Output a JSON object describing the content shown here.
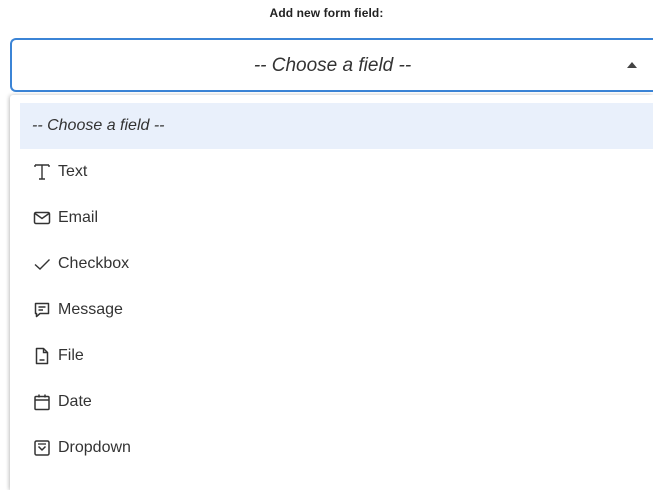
{
  "header": {
    "label": "Add new form field:"
  },
  "select": {
    "value": "-- Choose a field --",
    "expanded": true
  },
  "colors": {
    "accent_border": "#3b84d6",
    "selected_row": "#e9f0fb"
  },
  "menu": {
    "options": [
      {
        "label": "-- Choose a field --",
        "icon": "",
        "selected": true
      },
      {
        "label": "Text",
        "icon": "text-icon"
      },
      {
        "label": "Email",
        "icon": "envelope-icon"
      },
      {
        "label": "Checkbox",
        "icon": "checkmark-icon"
      },
      {
        "label": "Message",
        "icon": "message-icon"
      },
      {
        "label": "File",
        "icon": "file-icon"
      },
      {
        "label": "Date",
        "icon": "calendar-icon"
      },
      {
        "label": "Dropdown",
        "icon": "dropdown-icon"
      }
    ]
  }
}
